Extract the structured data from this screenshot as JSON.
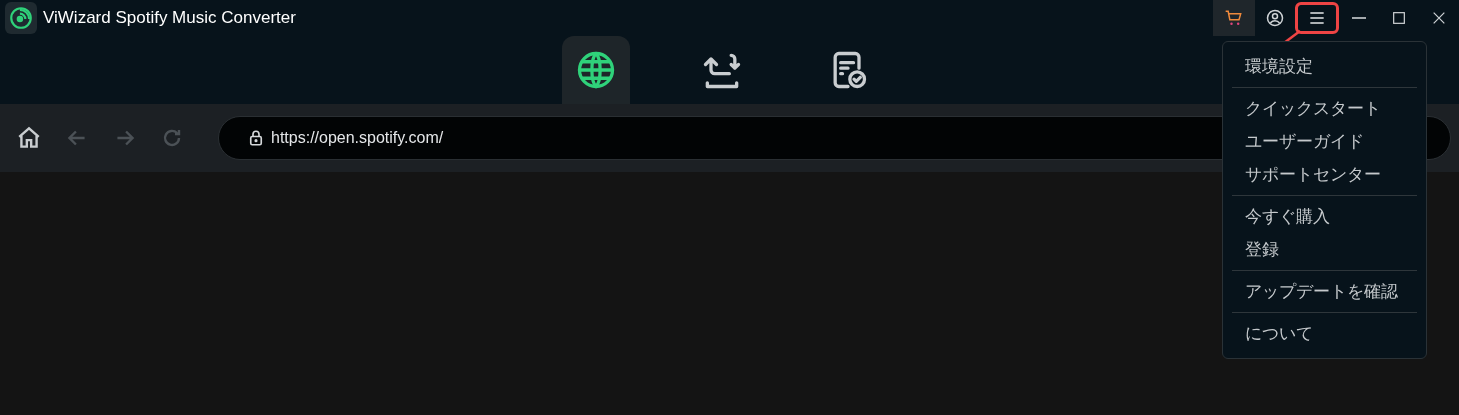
{
  "window": {
    "title": "ViWizard Spotify Music Converter"
  },
  "tabs": [
    {
      "kind": "web",
      "selected": true
    },
    {
      "kind": "convert",
      "selected": false
    },
    {
      "kind": "history",
      "selected": false
    }
  ],
  "address_bar": {
    "url": "https://open.spotify.com/"
  },
  "menu": {
    "open": true,
    "groups": [
      [
        "環境設定"
      ],
      [
        "クイックスタート",
        "ユーザーガイド",
        "サポートセンター"
      ],
      [
        "今すぐ購入",
        "登録"
      ],
      [
        "アップデートを確認"
      ],
      [
        "について"
      ]
    ]
  }
}
